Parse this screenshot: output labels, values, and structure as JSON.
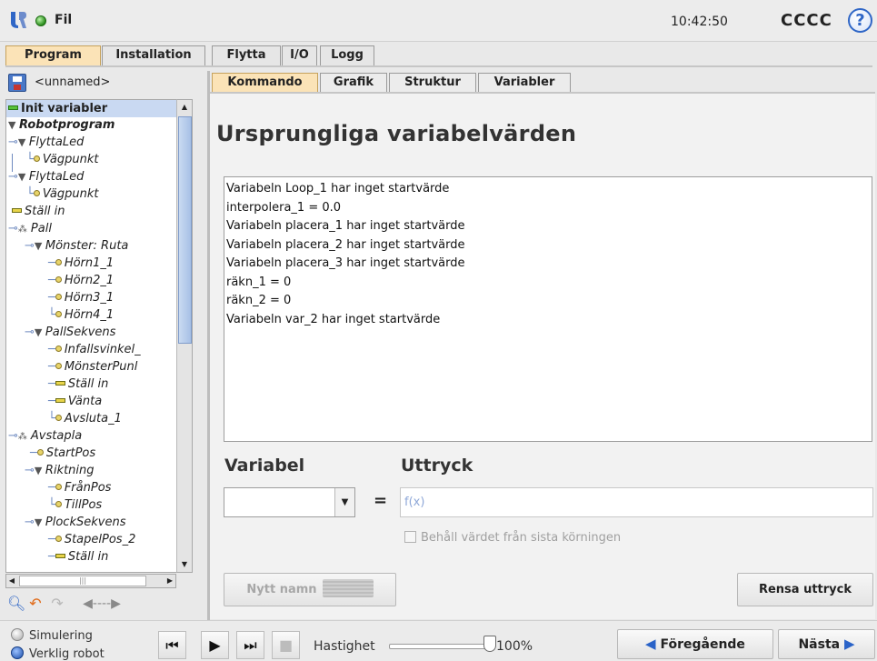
{
  "topbar": {
    "file_label": "Fil",
    "time": "10:42:50",
    "robot_name": "CCCC",
    "help": "?"
  },
  "main_tabs": [
    "Program",
    "Installation",
    "Flytta",
    "I/O",
    "Logg"
  ],
  "left": {
    "program_name": "<unnamed>",
    "tree": [
      {
        "label": "Init variabler",
        "style": "bold",
        "icon": "green-bar"
      },
      {
        "label": "Robotprogram",
        "style": "boldital",
        "icon": "triangle"
      },
      {
        "label": "FlyttaLed",
        "style": "ital",
        "icon": "triangle"
      },
      {
        "label": "Vägpunkt",
        "style": "ital",
        "icon": "dot"
      },
      {
        "label": "FlyttaLed",
        "style": "ital",
        "icon": "triangle"
      },
      {
        "label": "Vägpunkt",
        "style": "ital",
        "icon": "dot"
      },
      {
        "label": "Ställ in",
        "style": "ital",
        "icon": "bar"
      },
      {
        "label": "Pall",
        "style": "ital",
        "icon": "pall"
      },
      {
        "label": "Mönster: Ruta",
        "style": "ital",
        "icon": "triangle"
      },
      {
        "label": "Hörn1_1",
        "style": "ital",
        "icon": "dot"
      },
      {
        "label": "Hörn2_1",
        "style": "ital",
        "icon": "dot"
      },
      {
        "label": "Hörn3_1",
        "style": "ital",
        "icon": "dot"
      },
      {
        "label": "Hörn4_1",
        "style": "ital",
        "icon": "dot"
      },
      {
        "label": "PallSekvens",
        "style": "ital",
        "icon": "triangle"
      },
      {
        "label": "Infallsvinkel_",
        "style": "ital",
        "icon": "dot"
      },
      {
        "label": "MönsterPunl",
        "style": "ital",
        "icon": "dot"
      },
      {
        "label": "Ställ in",
        "style": "ital",
        "icon": "bar"
      },
      {
        "label": "Vänta",
        "style": "ital",
        "icon": "bar"
      },
      {
        "label": "Avsluta_1",
        "style": "ital",
        "icon": "dot"
      },
      {
        "label": "Avstapla",
        "style": "ital",
        "icon": "pall"
      },
      {
        "label": "StartPos",
        "style": "ital",
        "icon": "dot"
      },
      {
        "label": "Riktning",
        "style": "ital",
        "icon": "triangle"
      },
      {
        "label": "FrånPos",
        "style": "ital",
        "icon": "dot"
      },
      {
        "label": "TillPos",
        "style": "ital",
        "icon": "dot"
      },
      {
        "label": "PlockSekvens",
        "style": "ital",
        "icon": "triangle"
      },
      {
        "label": "StapelPos_2",
        "style": "ital",
        "icon": "dot"
      },
      {
        "label": "Ställ in",
        "style": "ital",
        "icon": "bar"
      }
    ]
  },
  "sub_tabs": [
    "Kommando",
    "Grafik",
    "Struktur",
    "Variabler"
  ],
  "main": {
    "heading": "Ursprungliga variabelvärden",
    "variables": [
      "Variabeln Loop_1 har inget startvärde",
      "interpolera_1 = 0.0",
      "Variabeln placera_1 har inget startvärde",
      "Variabeln placera_2 har inget startvärde",
      "Variabeln placera_3 har inget startvärde",
      "räkn_1 = 0",
      "räkn_2 = 0",
      "Variabeln var_2 har inget startvärde"
    ],
    "variable_label": "Variabel",
    "expression_label": "Uttryck",
    "equals": "=",
    "expression_placeholder": "f(x)",
    "keep_value_label": "Behåll värdet från sista körningen",
    "new_name_button": "Nytt namn",
    "clear_button": "Rensa uttryck"
  },
  "bottombar": {
    "simulation": "Simulering",
    "real_robot": "Verklig robot",
    "speed_label": "Hastighet",
    "speed_value": "100%",
    "previous": "Föregående",
    "next": "Nästa"
  }
}
